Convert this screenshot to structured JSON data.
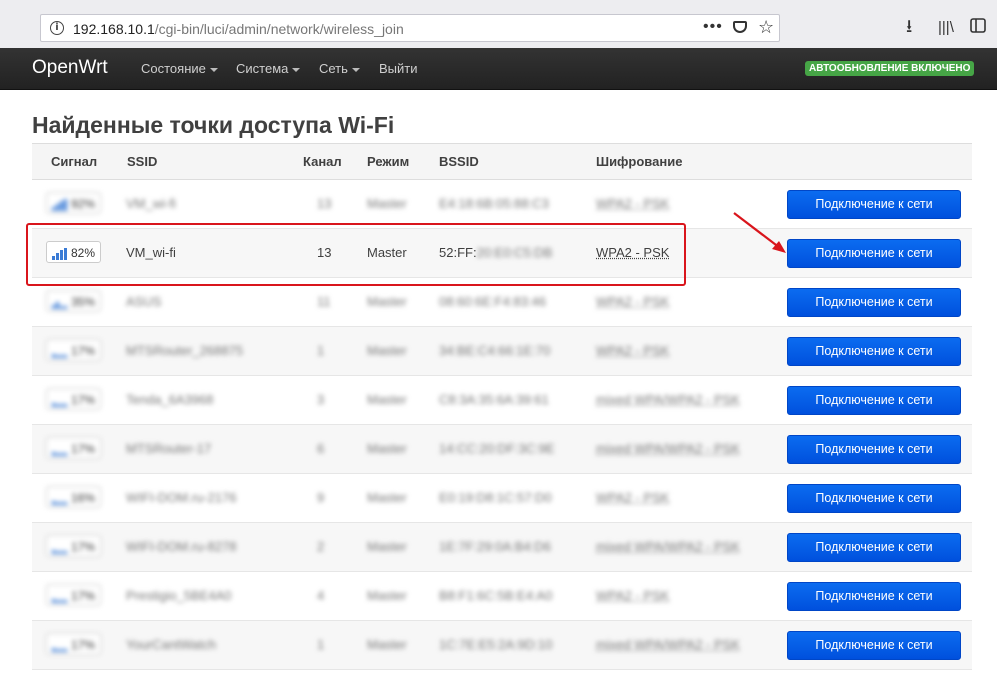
{
  "browser": {
    "url_host": "192.168.10.1",
    "url_path": "/cgi-bin/luci/admin/network/wireless_join",
    "more_label": "•••"
  },
  "navbar": {
    "brand": "OpenWrt",
    "menu": [
      "Состояние",
      "Система",
      "Сеть",
      "Выйти"
    ],
    "badge": "АВТООБНОВЛЕНИЕ ВКЛЮЧЕНО"
  },
  "page": {
    "title": "Найденные точки доступа Wi-Fi"
  },
  "table": {
    "headers": [
      "Сигнал",
      "SSID",
      "Канал",
      "Режим",
      "BSSID",
      "Шифрование"
    ],
    "connect_label": "Подключение к сети",
    "rows": [
      {
        "signal": "92%",
        "ssid": "VM_wi-fi",
        "channel": "13",
        "mode": "Master",
        "bssid": "E4:18:6B:05:88:C3",
        "encryption": "WPA2 - PSK",
        "blurred": true
      },
      {
        "signal": "82%",
        "ssid": "VM_wi-fi",
        "channel": "13",
        "mode": "Master",
        "bssid": "52:FF:",
        "bssid_hidden": "20:E0:C5:DB",
        "encryption": "WPA2 - PSK",
        "blurred": false
      },
      {
        "signal": "35%",
        "ssid": "ASUS",
        "channel": "11",
        "mode": "Master",
        "bssid": "08:60:6E:F4:83:46",
        "encryption": "WPA2 - PSK",
        "blurred": true
      },
      {
        "signal": "17%",
        "ssid": "MTSRouter_268875",
        "channel": "1",
        "mode": "Master",
        "bssid": "34:BE:C4:66:1E:70",
        "encryption": "WPA2 - PSK",
        "blurred": true
      },
      {
        "signal": "17%",
        "ssid": "Tenda_6A3968",
        "channel": "3",
        "mode": "Master",
        "bssid": "C8:3A:35:6A:39:61",
        "encryption": "mixed WPA/WPA2 - PSK",
        "blurred": true
      },
      {
        "signal": "17%",
        "ssid": "MTSRouter-17",
        "channel": "6",
        "mode": "Master",
        "bssid": "14:CC:20:DF:3C:9E",
        "encryption": "mixed WPA/WPA2 - PSK",
        "blurred": true
      },
      {
        "signal": "16%",
        "ssid": "WIFI-DOM.ru-2176",
        "channel": "9",
        "mode": "Master",
        "bssid": "E0:19:D8:1C:57:D0",
        "encryption": "WPA2 - PSK",
        "blurred": true
      },
      {
        "signal": "17%",
        "ssid": "WIFI-DOM.ru-8278",
        "channel": "2",
        "mode": "Master",
        "bssid": "1E:7F:29:0A:B4:D6",
        "encryption": "mixed WPA/WPA2 - PSK",
        "blurred": true
      },
      {
        "signal": "17%",
        "ssid": "Prestigio_5BE4A0",
        "channel": "4",
        "mode": "Master",
        "bssid": "B8:F1:6C:5B:E4:A0",
        "encryption": "WPA2 - PSK",
        "blurred": true
      },
      {
        "signal": "17%",
        "ssid": "YourCantWatch",
        "channel": "1",
        "mode": "Master",
        "bssid": "1C:7E:E5:2A:9D:10",
        "encryption": "mixed WPA/WPA2 - PSK",
        "blurred": true
      }
    ]
  },
  "colors": {
    "navbar_bg": "#222222",
    "badge_bg": "#46a546",
    "button_bg": "#0055e0",
    "signal_bars": "#3a7bd5",
    "annotation_red": "#d9151c"
  }
}
